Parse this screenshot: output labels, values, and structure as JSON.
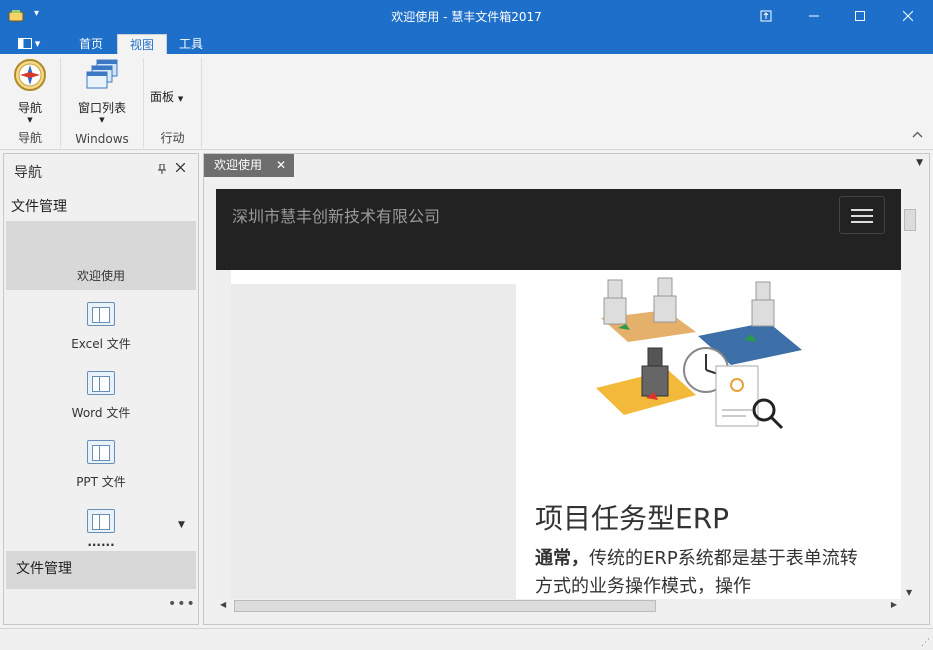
{
  "window": {
    "title": "欢迎使用 - 慧丰文件箱2017",
    "buttons": {
      "restore_icon": "pin-window-icon",
      "minimize": "—",
      "maximize": "☐",
      "close": "✕"
    }
  },
  "ribbon": {
    "file_menu_icon": "app-menu-icon",
    "tabs": [
      {
        "label": "首页",
        "active": false
      },
      {
        "label": "视图",
        "active": true
      },
      {
        "label": "工具",
        "active": false
      }
    ],
    "groups": [
      {
        "label": "导航",
        "buttons": [
          {
            "label": "导航",
            "icon": "compass-icon",
            "has_dropdown": true
          }
        ]
      },
      {
        "label": "Windows",
        "buttons": [
          {
            "label": "窗口列表",
            "icon": "window-list-icon",
            "has_dropdown": true
          }
        ]
      },
      {
        "label": "行动",
        "buttons": [
          {
            "label": "面板",
            "icon": "",
            "has_dropdown": true
          }
        ]
      }
    ]
  },
  "nav_pane": {
    "header": "导航",
    "group_title": "文件管理",
    "items": [
      {
        "label": "欢迎使用",
        "selected": true
      },
      {
        "label": "Excel 文件",
        "selected": false
      },
      {
        "label": "Word 文件",
        "selected": false
      },
      {
        "label": "PPT 文件",
        "selected": false
      },
      {
        "label": "......",
        "selected": false
      }
    ],
    "footer_group": "文件管理",
    "more": "•••"
  },
  "document": {
    "tab_label": "欢迎使用",
    "web": {
      "brand": "深圳市慧丰创新技术有限公司",
      "heading": "项目任务型ERP",
      "paragraph_lead": "通常，",
      "paragraph": "传统的ERP系统都是基于表单流转方式的业务操作模式，操作",
      "colors": {
        "navbar": "#222222",
        "brand_text": "#9a9a9a"
      }
    }
  },
  "theme": {
    "accent": "#1e6fc9"
  }
}
